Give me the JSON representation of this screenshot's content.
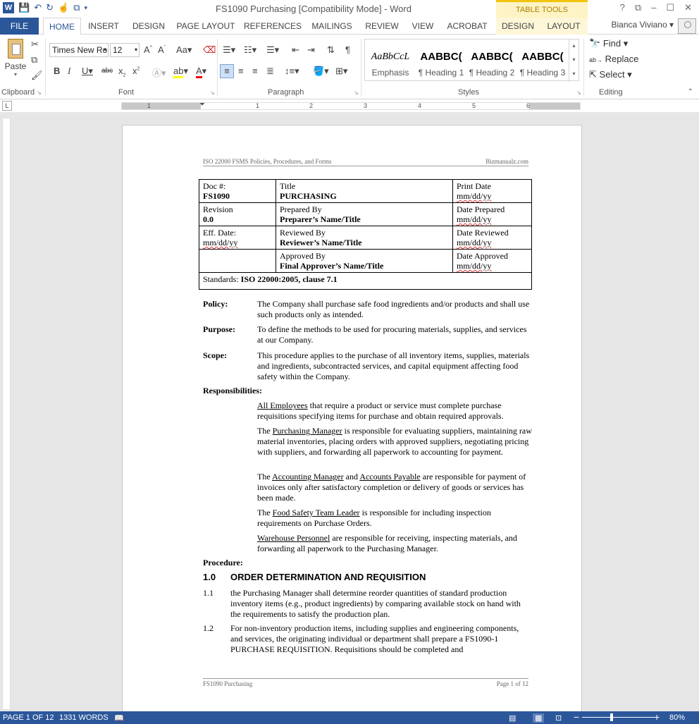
{
  "titlebar": {
    "title": "FS1090 Purchasing [Compatibility Mode] - Word",
    "table_tools": "TABLE TOOLS",
    "window_controls": [
      "?",
      "⧉",
      "–",
      "☐",
      "✕"
    ]
  },
  "tabs": {
    "file": "FILE",
    "items": [
      "HOME",
      "INSERT",
      "DESIGN",
      "PAGE LAYOUT",
      "REFERENCES",
      "MAILINGS",
      "REVIEW",
      "VIEW",
      "ACROBAT"
    ],
    "table_tabs": [
      "DESIGN",
      "LAYOUT"
    ],
    "active": "HOME",
    "user": "Bianca Viviano"
  },
  "ribbon": {
    "clipboard": {
      "paste": "Paste",
      "label": "Clipboard"
    },
    "font": {
      "name": "Times New Ro",
      "size": "12",
      "label": "Font"
    },
    "paragraph": {
      "label": "Paragraph"
    },
    "styles": {
      "label": "Styles",
      "items": [
        {
          "preview": "AaBbCcL",
          "name": "Emphasis"
        },
        {
          "preview": "AABBC(",
          "name": "¶ Heading 1"
        },
        {
          "preview": "AABBC(",
          "name": "¶ Heading 2"
        },
        {
          "preview": "AABBC(",
          "name": "¶ Heading 3"
        }
      ]
    },
    "editing": {
      "find": "Find",
      "replace": "Replace",
      "select": "Select",
      "label": "Editing"
    }
  },
  "ruler": {
    "numbers": [
      "1",
      "1",
      "2",
      "3",
      "4",
      "5",
      "6"
    ]
  },
  "document": {
    "header": {
      "left": "ISO 22000 FSMS Policies, Procedures, and Forms",
      "right": "Bizmanualz.com"
    },
    "table": {
      "doc_label": "Doc #:",
      "doc_value": "FS1090",
      "title_label": "Title",
      "title_value": "PURCHASING",
      "print_label": "Print Date",
      "print_value": "mm/dd/yy",
      "revision_label": "Revision",
      "revision_value": "0.0",
      "prepared_label": "Prepared By",
      "prepared_value": "Preparer’s Name/Title",
      "date_prepared_label": "Date Prepared",
      "date_prepared_value": "mm/dd/yy",
      "eff_label": "Eff. Date:",
      "eff_value": "mm/dd/yy",
      "reviewed_label": "Reviewed By",
      "reviewed_value": "Reviewer’s Name/Title",
      "date_reviewed_label": "Date Reviewed",
      "date_reviewed_value": "mm/dd/yy",
      "approved_label": "Approved By",
      "approved_value": "Final Approver’s Name/Title",
      "date_approved_label": "Date Approved",
      "date_approved_value": "mm/dd/yy",
      "standards_label": "Standards: ",
      "standards_value": "ISO 22000:2005, clause 7.1"
    },
    "policy": {
      "label": "Policy:",
      "text": "The Company shall purchase safe food ingredients and/or products and shall use such products only as intended."
    },
    "purpose": {
      "label": "Purpose:",
      "text": "To define the methods to be used for procuring materials, supplies, and services at our Company."
    },
    "scope": {
      "label": "Scope:",
      "text": "This procedure applies to the purchase of all inventory items, supplies, materials and ingredients, subcontracted services, and capital equipment affecting food safety within the Company."
    },
    "responsibilities": {
      "label": "Responsibilities:",
      "p1_role": "All Employees",
      "p1_rest": " that require a product or service must complete purchase requisitions specifying items for purchase and obtain required approvals.",
      "p2_pre": "The ",
      "p2_role": "Purchasing Manager",
      "p2_rest": " is responsible for evaluating suppliers, maintaining raw material inventories, placing orders with approved suppliers, negotiating pricing with suppliers, and forwarding all paperwork to accounting for payment.",
      "p3_pre": "The ",
      "p3_role1": "Accounting Manager",
      "p3_and": " and ",
      "p3_role2": "Accounts Payable",
      "p3_rest": " are responsible for payment of invoices only after satisfactory completion or delivery of goods or services has been made.",
      "p4_pre": "The ",
      "p4_role": "Food Safety Team Leader",
      "p4_rest": " is responsible for including inspection requirements on Purchase Orders.",
      "p5_role": "Warehouse Personnel",
      "p5_rest": " are responsible for receiving, inspecting materials, and forwarding all paperwork to the Purchasing Manager."
    },
    "procedure": {
      "label": "Procedure:",
      "h1_num": "1.0",
      "h1_text": "ORDER DETERMINATION AND REQUISITION",
      "s11_num": "1.1",
      "s11_text": "the Purchasing Manager shall determine reorder quantities of standard production inventory items (e.g., product ingredients) by comparing available stock on hand with the requirements to satisfy the  production plan.",
      "s12_num": "1.2",
      "s12_text": "For non-inventory production items, including supplies and engineering components, and services, the originating individual or department shall prepare a FS1090-1   PURCHASE REQUISITION.  Requisitions should be completed and"
    },
    "footer": {
      "left": "FS1090   Purchasing",
      "right": "Page 1 of 12"
    }
  },
  "statusbar": {
    "page": "PAGE 1 OF 12",
    "words": "1331 WORDS",
    "zoom": "80%",
    "zoom_fraction": 0.4
  }
}
